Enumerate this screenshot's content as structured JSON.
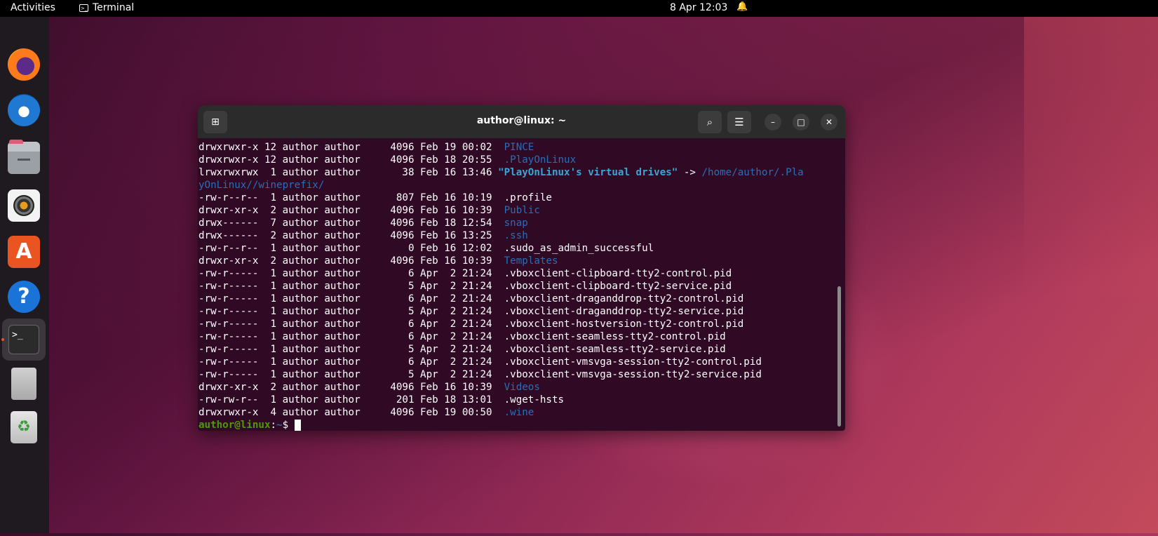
{
  "topbar": {
    "activities": "Activities",
    "app_name": "Terminal",
    "clock": "8 Apr  12:03"
  },
  "dock": {
    "items": [
      "firefox",
      "thunderbird",
      "files",
      "rhythmbox",
      "software",
      "help",
      "terminal",
      "drive",
      "trash"
    ]
  },
  "window": {
    "title": "author@linux: ~"
  },
  "terminal": {
    "lines": [
      {
        "meta": "drwxrwxr-x 12 author author     4096 Feb 19 00:02  ",
        "name": "PINCE",
        "style": "d"
      },
      {
        "meta": "drwxrwxr-x 12 author author     4096 Feb 18 20:55  ",
        "name": ".PlayOnLinux",
        "style": "d"
      },
      {
        "meta": "lrwxrwxrwx  1 author author       38 Feb 16 13:46 ",
        "name": "\"PlayOnLinux's virtual drives\"",
        "style": "s",
        "arrow": " -> ",
        "target": "/home/author/.Pla"
      },
      {
        "meta": "",
        "name": "yOnLinux//wineprefix/",
        "style": "d"
      },
      {
        "meta": "-rw-r--r--  1 author author      807 Feb 16 10:19  ",
        "name": ".profile",
        "style": ""
      },
      {
        "meta": "drwxr-xr-x  2 author author     4096 Feb 16 10:39  ",
        "name": "Public",
        "style": "d"
      },
      {
        "meta": "drwx------  7 author author     4096 Feb 18 12:54  ",
        "name": "snap",
        "style": "d"
      },
      {
        "meta": "drwx------  2 author author     4096 Feb 16 13:25  ",
        "name": ".ssh",
        "style": "d"
      },
      {
        "meta": "-rw-r--r--  1 author author        0 Feb 16 12:02  ",
        "name": ".sudo_as_admin_successful",
        "style": ""
      },
      {
        "meta": "drwxr-xr-x  2 author author     4096 Feb 16 10:39  ",
        "name": "Templates",
        "style": "d"
      },
      {
        "meta": "-rw-r-----  1 author author        6 Apr  2 21:24  ",
        "name": ".vboxclient-clipboard-tty2-control.pid",
        "style": ""
      },
      {
        "meta": "-rw-r-----  1 author author        5 Apr  2 21:24  ",
        "name": ".vboxclient-clipboard-tty2-service.pid",
        "style": ""
      },
      {
        "meta": "-rw-r-----  1 author author        6 Apr  2 21:24  ",
        "name": ".vboxclient-draganddrop-tty2-control.pid",
        "style": ""
      },
      {
        "meta": "-rw-r-----  1 author author        5 Apr  2 21:24  ",
        "name": ".vboxclient-draganddrop-tty2-service.pid",
        "style": ""
      },
      {
        "meta": "-rw-r-----  1 author author        6 Apr  2 21:24  ",
        "name": ".vboxclient-hostversion-tty2-control.pid",
        "style": ""
      },
      {
        "meta": "-rw-r-----  1 author author        6 Apr  2 21:24  ",
        "name": ".vboxclient-seamless-tty2-control.pid",
        "style": ""
      },
      {
        "meta": "-rw-r-----  1 author author        5 Apr  2 21:24  ",
        "name": ".vboxclient-seamless-tty2-service.pid",
        "style": ""
      },
      {
        "meta": "-rw-r-----  1 author author        6 Apr  2 21:24  ",
        "name": ".vboxclient-vmsvga-session-tty2-control.pid",
        "style": ""
      },
      {
        "meta": "-rw-r-----  1 author author        5 Apr  2 21:24  ",
        "name": ".vboxclient-vmsvga-session-tty2-service.pid",
        "style": ""
      },
      {
        "meta": "drwxr-xr-x  2 author author     4096 Feb 16 10:39  ",
        "name": "Videos",
        "style": "d"
      },
      {
        "meta": "-rw-rw-r--  1 author author      201 Feb 18 13:01  ",
        "name": ".wget-hsts",
        "style": ""
      },
      {
        "meta": "drwxrwxr-x  4 author author     4096 Feb 19 00:50  ",
        "name": ".wine",
        "style": "d"
      }
    ],
    "prompt_user": "author@linux",
    "prompt_sep": ":",
    "prompt_path": "~",
    "prompt_symbol": "$ "
  }
}
